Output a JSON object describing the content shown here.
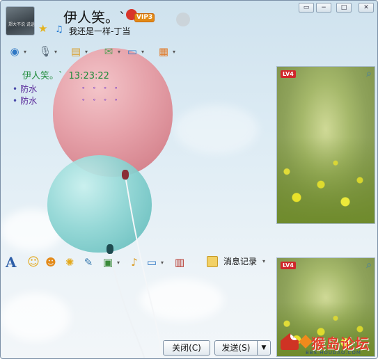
{
  "header": {
    "avatar_text": "郑大不说 说话",
    "name": "伊人笑。`",
    "vip_label": "VIP3",
    "signature": "我还是一样-丁当"
  },
  "window_controls": {
    "restore": "▭",
    "minimize": "−",
    "maximize": "□",
    "close": "✕"
  },
  "chat": {
    "sender": "伊人笑。`",
    "time": "13:23:22",
    "messages": [
      "防水",
      "防水"
    ],
    "dots_row": "∘∘∘∘"
  },
  "video_panels": [
    {
      "badge": "LV4"
    },
    {
      "badge": "LV4"
    }
  ],
  "input_toolbar": {
    "font_icon": "A",
    "history_label": "消息记录"
  },
  "buttons": {
    "close": "关闭(C)",
    "send": "发送(S)",
    "send_arrow": "▼"
  },
  "watermark": {
    "badge": "9",
    "brand": "猴岛论坛",
    "url": "BBS.HOUDAO.COM"
  },
  "icons": {
    "dropdown": "▾",
    "zoom": "⌕"
  }
}
